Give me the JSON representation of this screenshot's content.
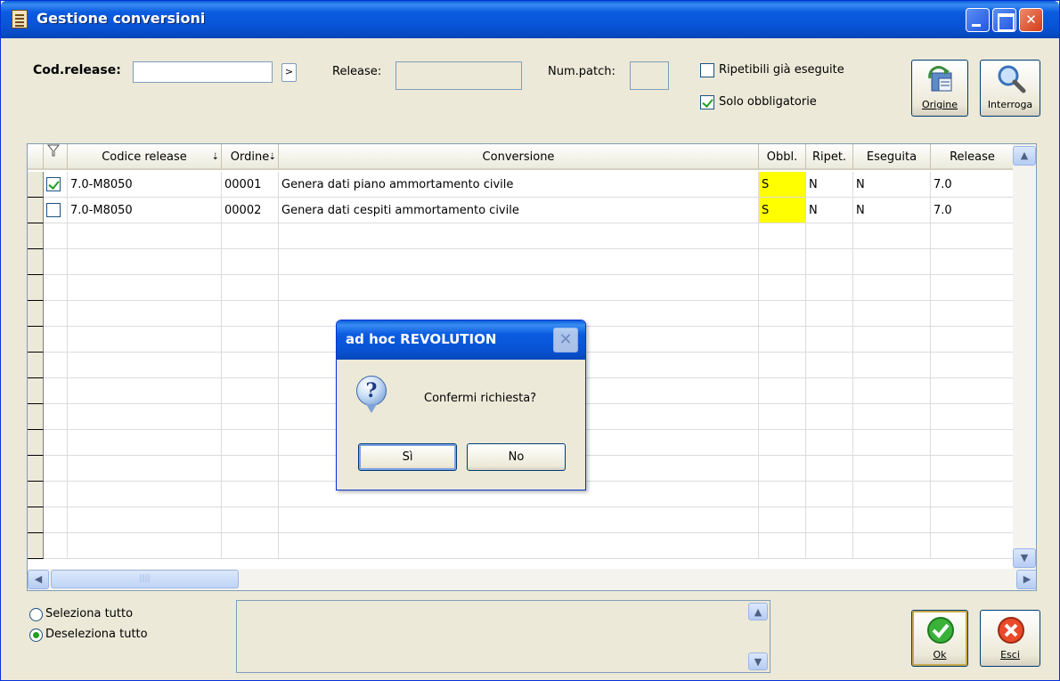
{
  "window": {
    "title": "Gestione conversioni"
  },
  "toolbar": {
    "cod_release_label": "Cod.release:",
    "cod_release_value": "",
    "release_label": "Release:",
    "release_value": "",
    "num_patch_label": "Num.patch:",
    "num_patch_value": "",
    "ripetibili_label": "Ripetibili già eseguite",
    "ripetibili_checked": false,
    "solo_obbligatorie_label": "Solo obbligatorie",
    "solo_obbligatorie_checked": true,
    "origine_label": "Origine",
    "interroga_label": "Interroga"
  },
  "grid": {
    "columns": [
      "Codice release",
      "Ordine",
      "Conversione",
      "Obbl.",
      "Ripet.",
      "Eseguita",
      "Release"
    ],
    "rows": [
      {
        "checked": true,
        "codice": "7.0-M8050",
        "ordine": "00001",
        "conversione": "Genera dati piano ammortamento civile",
        "obbl": "S",
        "ripet": "N",
        "eseguita": "N",
        "release": "7.0"
      },
      {
        "checked": false,
        "codice": "7.0-M8050",
        "ordine": "00002",
        "conversione": "Genera dati cespiti ammortamento civile",
        "obbl": "S",
        "ripet": "N",
        "eseguita": "N",
        "release": "7.0"
      }
    ]
  },
  "footer": {
    "seleziona_tutto": "Seleziona tutto",
    "deseleziona_tutto": "Deseleziona tutto",
    "selected_option": "deseleziona_tutto",
    "ok_label": "Ok",
    "esci_label": "Esci"
  },
  "dialog": {
    "title": "ad hoc REVOLUTION",
    "message": "Confermi richiesta?",
    "yes_label": "Sì",
    "no_label": "No"
  },
  "colors": {
    "title_bar": "#0853d4",
    "window_bg": "#ece9d8",
    "obbl_highlight": "#ffff00"
  }
}
